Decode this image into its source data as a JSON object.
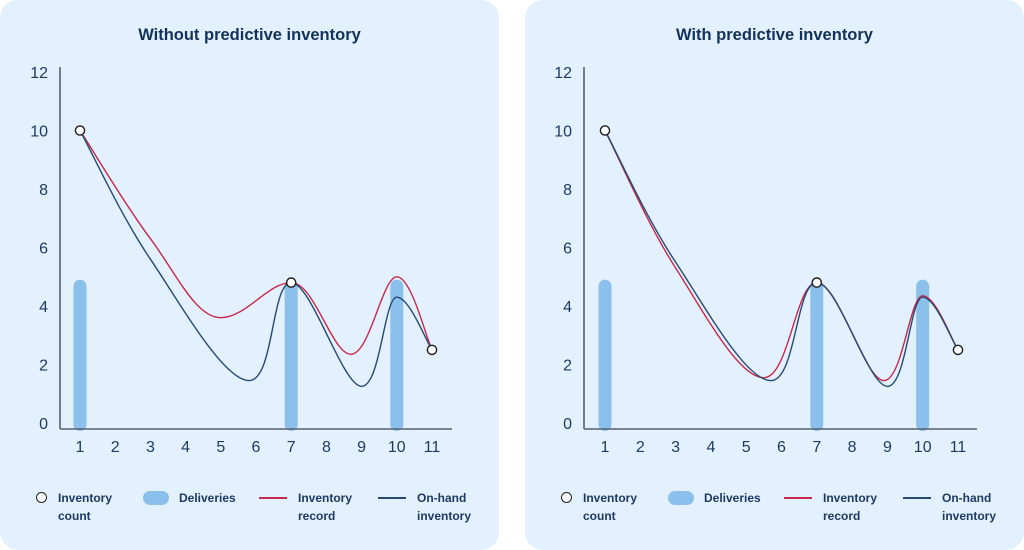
{
  "colors": {
    "background": "#e3f0fe",
    "title": "#12325a",
    "inventory_record": "#c8284a",
    "on_hand_inventory": "#264a72",
    "deliveries": "#8bbfec",
    "axis": "#55606e"
  },
  "legend": {
    "inventory_count": [
      "Inventory",
      "count"
    ],
    "deliveries": [
      "Deliveries"
    ],
    "inventory_record": [
      "Inventory",
      "record"
    ],
    "on_hand_inventory": [
      "On-hand",
      "inventory"
    ]
  },
  "chart_data": [
    {
      "type": "line",
      "title": "Without predictive inventory",
      "xlabel": "",
      "ylabel": "",
      "x_ticks": [
        "1",
        "2",
        "3",
        "4",
        "5",
        "6",
        "7",
        "8",
        "9",
        "10",
        "11"
      ],
      "y_ticks": [
        "0",
        "2",
        "4",
        "6",
        "8",
        "10",
        "12"
      ],
      "xlim": [
        0.4,
        12
      ],
      "ylim": [
        0,
        12
      ],
      "grid": false,
      "legend_position": "bottom",
      "inventory_count": [
        {
          "x": 1,
          "y": 10
        },
        {
          "x": 7,
          "y": 4.8
        },
        {
          "x": 11,
          "y": 2.5
        }
      ],
      "deliveries": [
        {
          "x": 1,
          "y": 4.9
        },
        {
          "x": 7,
          "y": 4.9
        },
        {
          "x": 10,
          "y": 4.9
        }
      ],
      "series": [
        {
          "name": "Inventory record",
          "key": "inventory_record",
          "points": [
            [
              1,
              10
            ],
            [
              3,
              6.3
            ],
            [
              5,
              3.6
            ],
            [
              7,
              4.8
            ],
            [
              8.7,
              2.35
            ],
            [
              10,
              5.0
            ],
            [
              11,
              2.5
            ]
          ]
        },
        {
          "name": "On-hand inventory",
          "key": "on_hand_inventory",
          "points": [
            [
              1,
              10
            ],
            [
              3,
              5.6
            ],
            [
              5.8,
              1.45
            ],
            [
              7,
              4.8
            ],
            [
              9,
              1.25
            ],
            [
              10,
              4.3
            ],
            [
              11,
              2.5
            ]
          ]
        }
      ]
    },
    {
      "type": "line",
      "title": "With predictive inventory",
      "xlabel": "",
      "ylabel": "",
      "x_ticks": [
        "1",
        "2",
        "3",
        "4",
        "5",
        "6",
        "7",
        "8",
        "9",
        "10",
        "11"
      ],
      "y_ticks": [
        "0",
        "2",
        "4",
        "6",
        "8",
        "10",
        "12"
      ],
      "xlim": [
        0.4,
        12
      ],
      "ylim": [
        0,
        12
      ],
      "grid": false,
      "legend_position": "bottom",
      "inventory_count": [
        {
          "x": 1,
          "y": 10
        },
        {
          "x": 7,
          "y": 4.8
        },
        {
          "x": 11,
          "y": 2.5
        }
      ],
      "deliveries": [
        {
          "x": 1,
          "y": 4.9
        },
        {
          "x": 7,
          "y": 4.9
        },
        {
          "x": 10,
          "y": 4.9
        }
      ],
      "series": [
        {
          "name": "Inventory record",
          "key": "inventory_record",
          "points": [
            [
              1,
              10
            ],
            [
              3,
              5.3
            ],
            [
              5.5,
              1.55
            ],
            [
              7,
              4.8
            ],
            [
              8.9,
              1.45
            ],
            [
              10,
              4.35
            ],
            [
              11,
              2.5
            ]
          ]
        },
        {
          "name": "On-hand inventory",
          "key": "on_hand_inventory",
          "points": [
            [
              1,
              10
            ],
            [
              3,
              5.5
            ],
            [
              5.7,
              1.45
            ],
            [
              7,
              4.8
            ],
            [
              9,
              1.25
            ],
            [
              10,
              4.3
            ],
            [
              11,
              2.5
            ]
          ]
        }
      ]
    }
  ]
}
